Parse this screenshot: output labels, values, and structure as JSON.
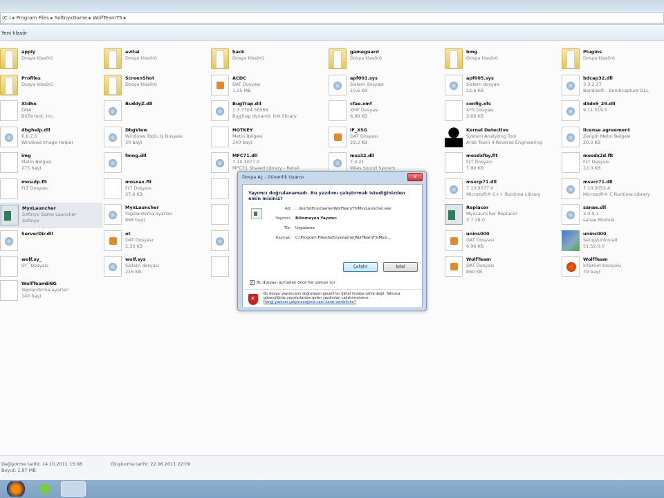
{
  "address": {
    "crumbs": [
      "(C:)",
      "Program Files",
      "SoftnyxGame",
      "WolfTeamTS"
    ],
    "separator": "▸"
  },
  "toolbar": {
    "label": "Yeni klasör"
  },
  "columns": [
    [
      {
        "name": "apply",
        "lines": [
          "Dosya klasörü"
        ],
        "icon": "folder"
      },
      {
        "name": "Profiles",
        "lines": [
          "Dosya klasörü"
        ],
        "icon": "folder"
      },
      {
        "name": "Xtdhe",
        "lines": [
          "DNA",
          "BitTorrent, Inc."
        ],
        "icon": "file"
      },
      {
        "name": "dbghelp.dll",
        "lines": [
          "6.8.7.5",
          "Windows Image Helper"
        ],
        "icon": "dll"
      },
      {
        "name": "img",
        "lines": [
          "Metin Belgesi",
          "275 bayt"
        ],
        "icon": "file"
      },
      {
        "name": "mosulp.flt",
        "lines": [
          "FLT Dosyası"
        ],
        "icon": "file"
      },
      {
        "name": "MyxLauncher",
        "lines": [
          "Softnyx Game Launcher",
          "Softnyx"
        ],
        "icon": "app",
        "selected": true
      },
      {
        "name": "ServerDir.dll",
        "lines": [],
        "icon": "dll"
      },
      {
        "name": "wolf.sy_",
        "lines": [
          "SY_ Dosyası"
        ],
        "icon": "file"
      },
      {
        "name": "WolfTeamENG",
        "lines": [
          "Yapılandırma ayarları",
          "140 bayt"
        ],
        "icon": "file"
      }
    ],
    [
      {
        "name": "avitai",
        "lines": [
          "Dosya klasörü"
        ],
        "icon": "folder"
      },
      {
        "name": "ScreenShot",
        "lines": [
          "Dosya klasörü"
        ],
        "icon": "folder"
      },
      {
        "name": "BuddyZ.dll",
        "lines": [],
        "icon": "dll"
      },
      {
        "name": "DbgView",
        "lines": [
          "Windows Toplu İş Dosyası",
          "30 bayt"
        ],
        "icon": "dll"
      },
      {
        "name": "fmng.dll",
        "lines": [],
        "icon": "dll"
      },
      {
        "name": "mosxax.flt",
        "lines": [
          "FLT Dosyası",
          "37,6 KB"
        ],
        "icon": "file"
      },
      {
        "name": "MyxLauncher",
        "lines": [
          "Yapılandırma ayarları",
          "868 bayt"
        ],
        "icon": "dll"
      },
      {
        "name": "ot",
        "lines": [
          "DAT Dosyası",
          "2,33 KB"
        ],
        "icon": "dat"
      },
      {
        "name": "wolf.sys",
        "lines": [
          "Sistem dosyası",
          "216 KB"
        ],
        "icon": "dll"
      }
    ],
    [
      {
        "name": "hack",
        "lines": [
          "Dosya klasörü"
        ],
        "icon": "folder"
      },
      {
        "name": "ACDC",
        "lines": [
          "DAT Dosyası",
          "1,35 MB"
        ],
        "icon": "dat"
      },
      {
        "name": "BugTrap.dll",
        "lines": [
          "1.3.3704.36558",
          "BugTrap dynamic link library"
        ],
        "icon": "dll"
      },
      {
        "name": "HOTKEY",
        "lines": [
          "Metin Belgesi",
          "240 bayt"
        ],
        "icon": "file"
      },
      {
        "name": "MFC71.dll",
        "lines": [
          "7.10.3077.0",
          "MFC71 Shared Library - Retail"
        ],
        "icon": "dll"
      },
      {
        "name": "",
        "lines": [],
        "icon": "file"
      },
      {
        "name": "",
        "lines": [],
        "icon": "file"
      },
      {
        "name": "",
        "lines": [],
        "icon": "dll"
      },
      {
        "name": "",
        "lines": [],
        "icon": "file"
      }
    ],
    [
      {
        "name": "gameguard",
        "lines": [
          "Dosya klasörü"
        ],
        "icon": "folder"
      },
      {
        "name": "apf001.sys",
        "lines": [
          "Sistem dosyası",
          "10,6 KB"
        ],
        "icon": "dll"
      },
      {
        "name": "cfae.xmf",
        "lines": [
          "XMF Dosyası",
          "6,98 KB"
        ],
        "icon": "file"
      },
      {
        "name": "IF_XSG",
        "lines": [
          "DAT Dosyası",
          "29,2 KB"
        ],
        "icon": "dat"
      },
      {
        "name": "mss32.dll",
        "lines": [
          "7.0.21",
          "Miles Sound System"
        ],
        "icon": "dll"
      }
    ],
    [
      {
        "name": "bmg",
        "lines": [
          "Dosya klasörü"
        ],
        "icon": "folder"
      },
      {
        "name": "apf005.sys",
        "lines": [
          "Sistem dosyası",
          "12,6 KB"
        ],
        "icon": "dll"
      },
      {
        "name": "config.xfs",
        "lines": [
          "XFS Dosyası",
          "3,66 KB"
        ],
        "icon": "file"
      },
      {
        "name": "Kernel Detective",
        "lines": [
          "System Analyzing Tool",
          "Arab Team 4 Reverse Engineering"
        ],
        "icon": "person"
      },
      {
        "name": "mosdxfby.flt",
        "lines": [
          "FLT Dosyası",
          "7,90 KB"
        ],
        "icon": "file"
      },
      {
        "name": "msvcp71.dll",
        "lines": [
          "7.10.3077.0",
          "Microsoft® C++ Runtime Library"
        ],
        "icon": "dll"
      },
      {
        "name": "Replacer",
        "lines": [
          "MyxLauncher Replacer",
          "3.7.28.0"
        ],
        "icon": "app"
      },
      {
        "name": "unins000",
        "lines": [
          "DAT Dosyası",
          "6,96 KB"
        ],
        "icon": "dat"
      },
      {
        "name": "WolfTeam",
        "lines": [
          "DAT Dosyası",
          "869 KB"
        ],
        "icon": "dat"
      }
    ],
    [
      {
        "name": "Plugins",
        "lines": [
          "Dosya klasörü"
        ],
        "icon": "folder"
      },
      {
        "name": "bdcap32.dll",
        "lines": [
          "3.3.2.37",
          "Bandisoft - Bandicapture DLL"
        ],
        "icon": "dll"
      },
      {
        "name": "d3dx9_29.dll",
        "lines": [
          "9.11.519.0"
        ],
        "icon": "dll"
      },
      {
        "name": "license agreement",
        "lines": [
          "Zengin Metin Belgesi",
          "20,3 KB"
        ],
        "icon": "dll"
      },
      {
        "name": "mosdx2d.flt",
        "lines": [
          "FLT Dosyası",
          "12,0 KB"
        ],
        "icon": "file"
      },
      {
        "name": "msvcr71.dll",
        "lines": [
          "7.10.3052.4",
          "Microsoft® C Runtime Library"
        ],
        "icon": "dll"
      },
      {
        "name": "sanae.dll",
        "lines": [
          "3.0.0.1",
          "sanae Module"
        ],
        "icon": "dll"
      },
      {
        "name": "unins000",
        "lines": [
          "Setup/Uninstall",
          "51.52.0.0"
        ],
        "icon": "setup"
      },
      {
        "name": "WolfTeam",
        "lines": [
          "İnternet Kısayolu",
          "79 bayt"
        ],
        "icon": "link"
      }
    ]
  ],
  "status": {
    "modified": "Değiştirme tarihi: 14.10.2011 15:08",
    "size": "Boyut: 1,97 MB",
    "created": "Oluşturma tarihi: 22.06.2011 22:09"
  },
  "dialog": {
    "title": "Dosya Aç - Güvenlik Uyarısı",
    "close": "✕",
    "heading": "Yayımcı doğrulanamadı. Bu yazılımı çalıştırmak istediğinizden emin misiniz?",
    "fields": [
      {
        "label": "Ad:",
        "value": "...iles\\SoftnyxGame\\WolfTeamTS\\MyxLauncher.exe"
      },
      {
        "label": "Yayımcı:",
        "value": "Bilinmeyen Yayımcı"
      },
      {
        "label": "Tür:",
        "value": "Uygulama"
      },
      {
        "label": "Kaynak:",
        "value": "C:\\Program Files\\SoftnyxGame\\WolfTeamTS\\Myxl..."
      }
    ],
    "run": "Çalıştır",
    "cancel": "İptal",
    "checkbox": "Bu dosyayı açmadan önce her zaman sor",
    "checked": true,
    "warning": "Bu dosya, yayımcısını doğrulayan geçerli bir dijital imzaya sahip değil. Yalnızca güvendiğiniz yayımcılardan gelen yazılımları çalıştırmalısınız.",
    "link": "Hangi yazılımı çalıştıracağıma nasıl karar verebilirim?"
  }
}
